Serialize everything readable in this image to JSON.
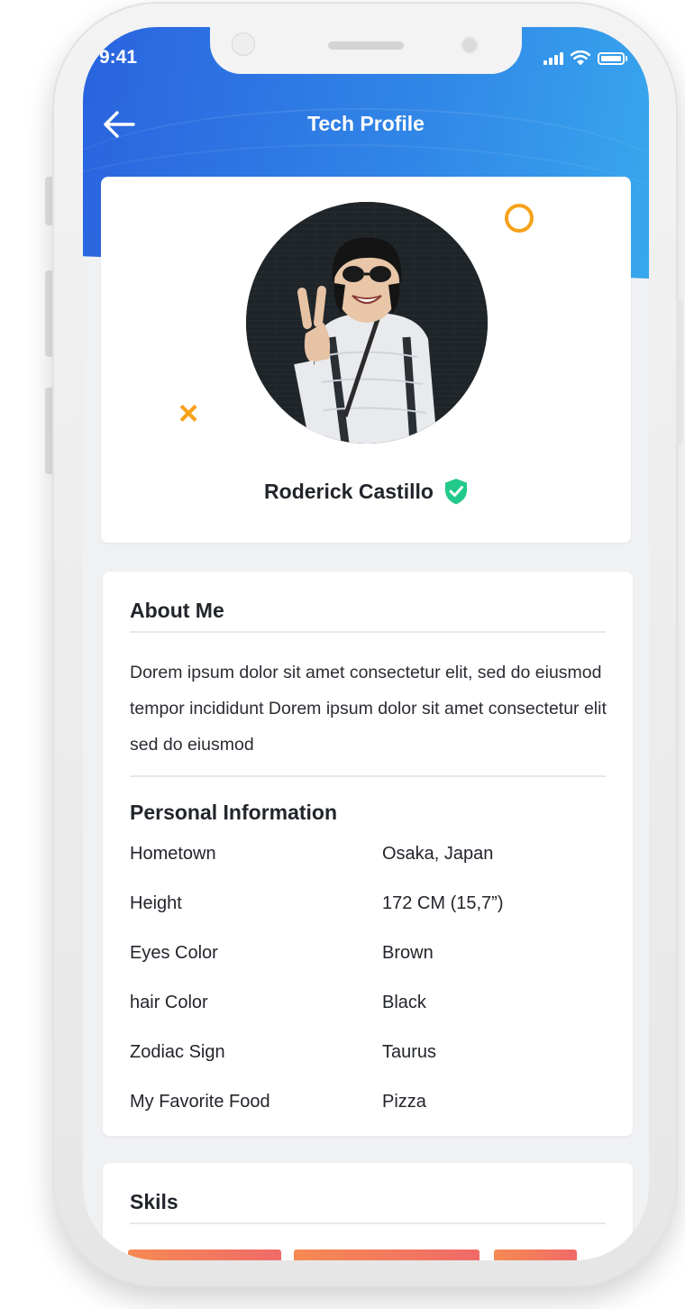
{
  "status": {
    "time": "9:41"
  },
  "header": {
    "title": "Tech Profile"
  },
  "profile": {
    "name": "Roderick Castillo"
  },
  "about": {
    "title": "About Me",
    "text": "Dorem ipsum dolor sit amet consectetur elit, sed do eiusmod tempor incididunt Dorem ipsum dolor sit amet consectetur elit sed do eiusmod"
  },
  "personal": {
    "title": "Personal Information",
    "rows": [
      {
        "label": "Hometown",
        "value": "Osaka, Japan"
      },
      {
        "label": "Height",
        "value": "172 CM (15,7”)"
      },
      {
        "label": "Eyes Color",
        "value": "Brown"
      },
      {
        "label": "hair Color",
        "value": "Black"
      },
      {
        "label": "Zodiac Sign",
        "value": "Taurus"
      },
      {
        "label": "My Favorite Food",
        "value": "Pizza"
      }
    ]
  },
  "skills": {
    "title": "Skils"
  },
  "colors": {
    "header_start": "#2a63df",
    "header_end": "#38a8ee",
    "accent": "#f7a21b",
    "verified": "#22c98a",
    "skill": "#f06a68"
  }
}
